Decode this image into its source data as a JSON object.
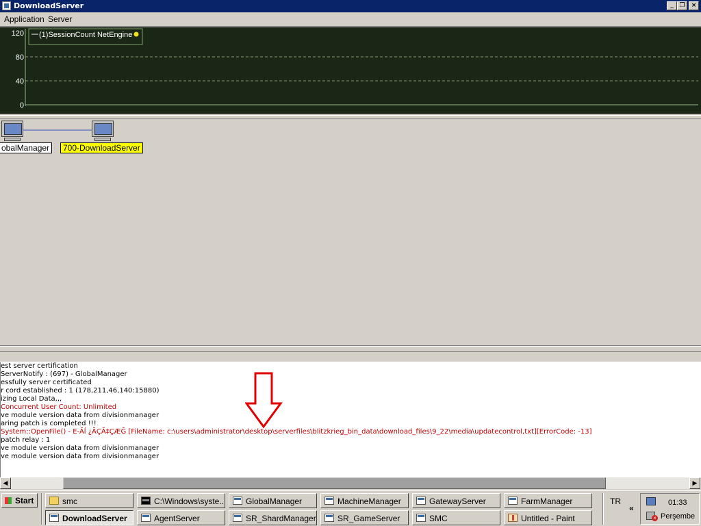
{
  "window": {
    "title": "DownloadServer",
    "controls": {
      "minimize": "_",
      "restore": "❐",
      "close": "×"
    }
  },
  "menubar": {
    "items": [
      "Application",
      "Server"
    ]
  },
  "monitor_chart": {
    "legend": "(1)SessionCount NetEngine",
    "legend_marker_color": "#f0e020"
  },
  "chart_data": {
    "type": "line",
    "title": "",
    "xlabel": "",
    "ylabel": "",
    "y_ticks": [
      "120",
      "80",
      "40",
      "0"
    ],
    "ylim": [
      0,
      120
    ],
    "grid": true,
    "legend_position": "top-left",
    "series": [
      {
        "name": "(1)SessionCount NetEngine",
        "values": [
          0,
          0
        ],
        "color": "#9ab88a"
      }
    ]
  },
  "topology": {
    "nodes": [
      {
        "label": "obalManager",
        "highlight": false
      },
      {
        "label": "700-DownloadServer",
        "highlight": true,
        "color": "#ffff00"
      }
    ]
  },
  "log": {
    "lines": [
      {
        "text": "est server certification",
        "error": false
      },
      {
        "text": "ServerNotify : (697) - GlobalManager",
        "error": false
      },
      {
        "text": "essfully server certificated",
        "error": false
      },
      {
        "text": "r cord established : 1 (178,211,46,140:15880)",
        "error": false
      },
      {
        "text": "izing Local Data,,,",
        "error": false
      },
      {
        "text": "Concurrent User Count: Unlimited",
        "error": true
      },
      {
        "text": "ve module version data from divisionmanager",
        "error": false
      },
      {
        "text": "aring patch is completed !!!",
        "error": false
      },
      {
        "text": "System::OpenFile() - E-Ăĺ ¿ĂÇĂ‡ÇÆĞ [FileName: c:\\users\\administrator\\desktop\\serverfiles\\blitzkrieg_bin_data\\download_files\\9_22\\media\\updatecontrol,txt][ErrorCode: -13]",
        "error": true
      },
      {
        "text": "patch relay : 1",
        "error": false
      },
      {
        "text": "ve module version data from divisionmanager",
        "error": false
      },
      {
        "text": "ve module version data from divisionmanager",
        "error": false
      }
    ]
  },
  "scrollbar": {
    "left_arrow": "◀",
    "right_arrow": "▶",
    "thumb_start": 0.09,
    "thumb_fraction": 0.78
  },
  "taskbar": {
    "start_label": "Start",
    "tasks": [
      {
        "label": "smc",
        "icon": "folder-icon",
        "active": false
      },
      {
        "label": "C:\\Windows\\syste...",
        "icon": "cmd-icon",
        "active": false
      },
      {
        "label": "GlobalManager",
        "icon": "window-icon",
        "active": false
      },
      {
        "label": "MachineManager",
        "icon": "window-icon",
        "active": false
      },
      {
        "label": "GatewayServer",
        "icon": "window-icon",
        "active": false
      },
      {
        "label": "FarmManager",
        "icon": "window-icon",
        "active": false
      },
      {
        "label": "DownloadServer",
        "icon": "window-icon",
        "active": true
      },
      {
        "label": "AgentServer",
        "icon": "window-icon",
        "active": false
      },
      {
        "label": "SR_ShardManager",
        "icon": "window-icon",
        "active": false
      },
      {
        "label": "SR_GameServer",
        "icon": "window-icon",
        "active": false
      },
      {
        "label": "SMC",
        "icon": "window-icon",
        "active": false
      },
      {
        "label": "Untitled - Paint",
        "icon": "paint-icon",
        "active": false
      }
    ],
    "language": "TR",
    "chevron": "«",
    "clock": "01:33",
    "day": "Perşembe"
  }
}
